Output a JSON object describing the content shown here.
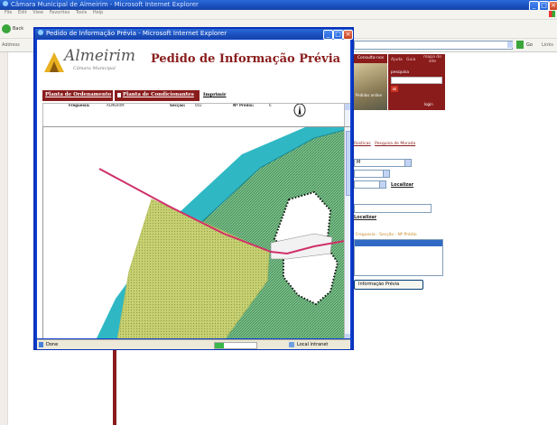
{
  "main_window": {
    "title": "Câmara Municipal de Almeirim - Microsoft Internet Explorer",
    "menu": [
      "File",
      "Edit",
      "View",
      "Favorites",
      "Tools",
      "Help"
    ],
    "back_label": "Back",
    "address_label": "Address",
    "go_label": "Go",
    "links_label": "Links"
  },
  "right_panel": {
    "tab1": "Consulta-nos",
    "tab2": "Ajuda",
    "tab3": "Guia",
    "tab4": "mapa do site",
    "search_label": "pesquisa",
    "search_button": "ok",
    "login_label": "login",
    "links": [
      "Rústicas",
      "Pesquisa de Morada"
    ],
    "select_value": "M",
    "localizar_link": "Localizar",
    "localizar2_link": "Localizar",
    "list_header": "Freguesia - Secção - Nº Prédio",
    "button_label": "Informação Prévia",
    "photo_caption": "Pedidos online"
  },
  "popup": {
    "title": "Pedido de Informação Prévia - Microsoft Internet Explorer",
    "logo_text": "Almeirim",
    "logo_sub": "Câmara Municipal",
    "heading": "Pedido de Informação Prévia",
    "tabs": [
      "Planta de Ordenamento",
      "Planta de Condicionantes",
      "Imprimir"
    ],
    "info_freguesia_label": "Freguesia:",
    "info_freguesia_value": "ALMEIRIM",
    "info_seccao_label": "Secção:",
    "info_seccao_value": "002",
    "info_predio_label": "Nº Prédio:",
    "info_predio_value": "6",
    "status_done": "Done",
    "status_zone": "Local intranet"
  },
  "colors": {
    "xp_blue": "#1a4fbf",
    "maroon": "#8a1c1c",
    "river": "#2fb8c4",
    "green_hatch": "#4a9a5a",
    "yellow_area": "#c8d070",
    "road": "#d0306a"
  }
}
